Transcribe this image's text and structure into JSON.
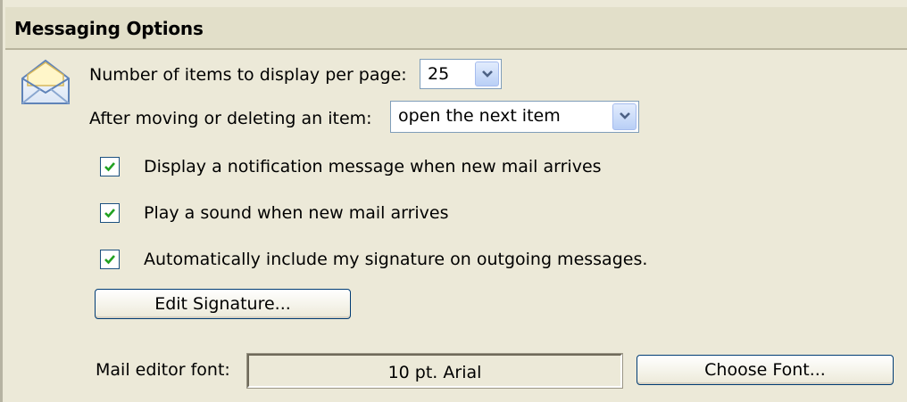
{
  "section": {
    "title": "Messaging Options"
  },
  "icons": {
    "envelope": "envelope-icon",
    "dropdown": "chevron-down-icon",
    "check": "checkmark-icon"
  },
  "items_per_page": {
    "label": "Number of items to display per page:",
    "value": "25"
  },
  "after_moving": {
    "label": "After moving or deleting an item:",
    "value": "open the next item"
  },
  "checkboxes": [
    {
      "label": "Display a notification message when new mail arrives",
      "checked": true
    },
    {
      "label": "Play a sound when new mail arrives",
      "checked": true
    },
    {
      "label": "Automatically include my signature on outgoing messages.",
      "checked": true
    }
  ],
  "edit_signature_button": "Edit Signature...",
  "mail_editor_font": {
    "label": "Mail editor font:",
    "value": "10 pt. Arial",
    "button": "Choose Font..."
  },
  "colors": {
    "background": "#ece9d8",
    "header": "#e2dfc9",
    "check": "#21a121",
    "accent_border": "#003c74"
  }
}
